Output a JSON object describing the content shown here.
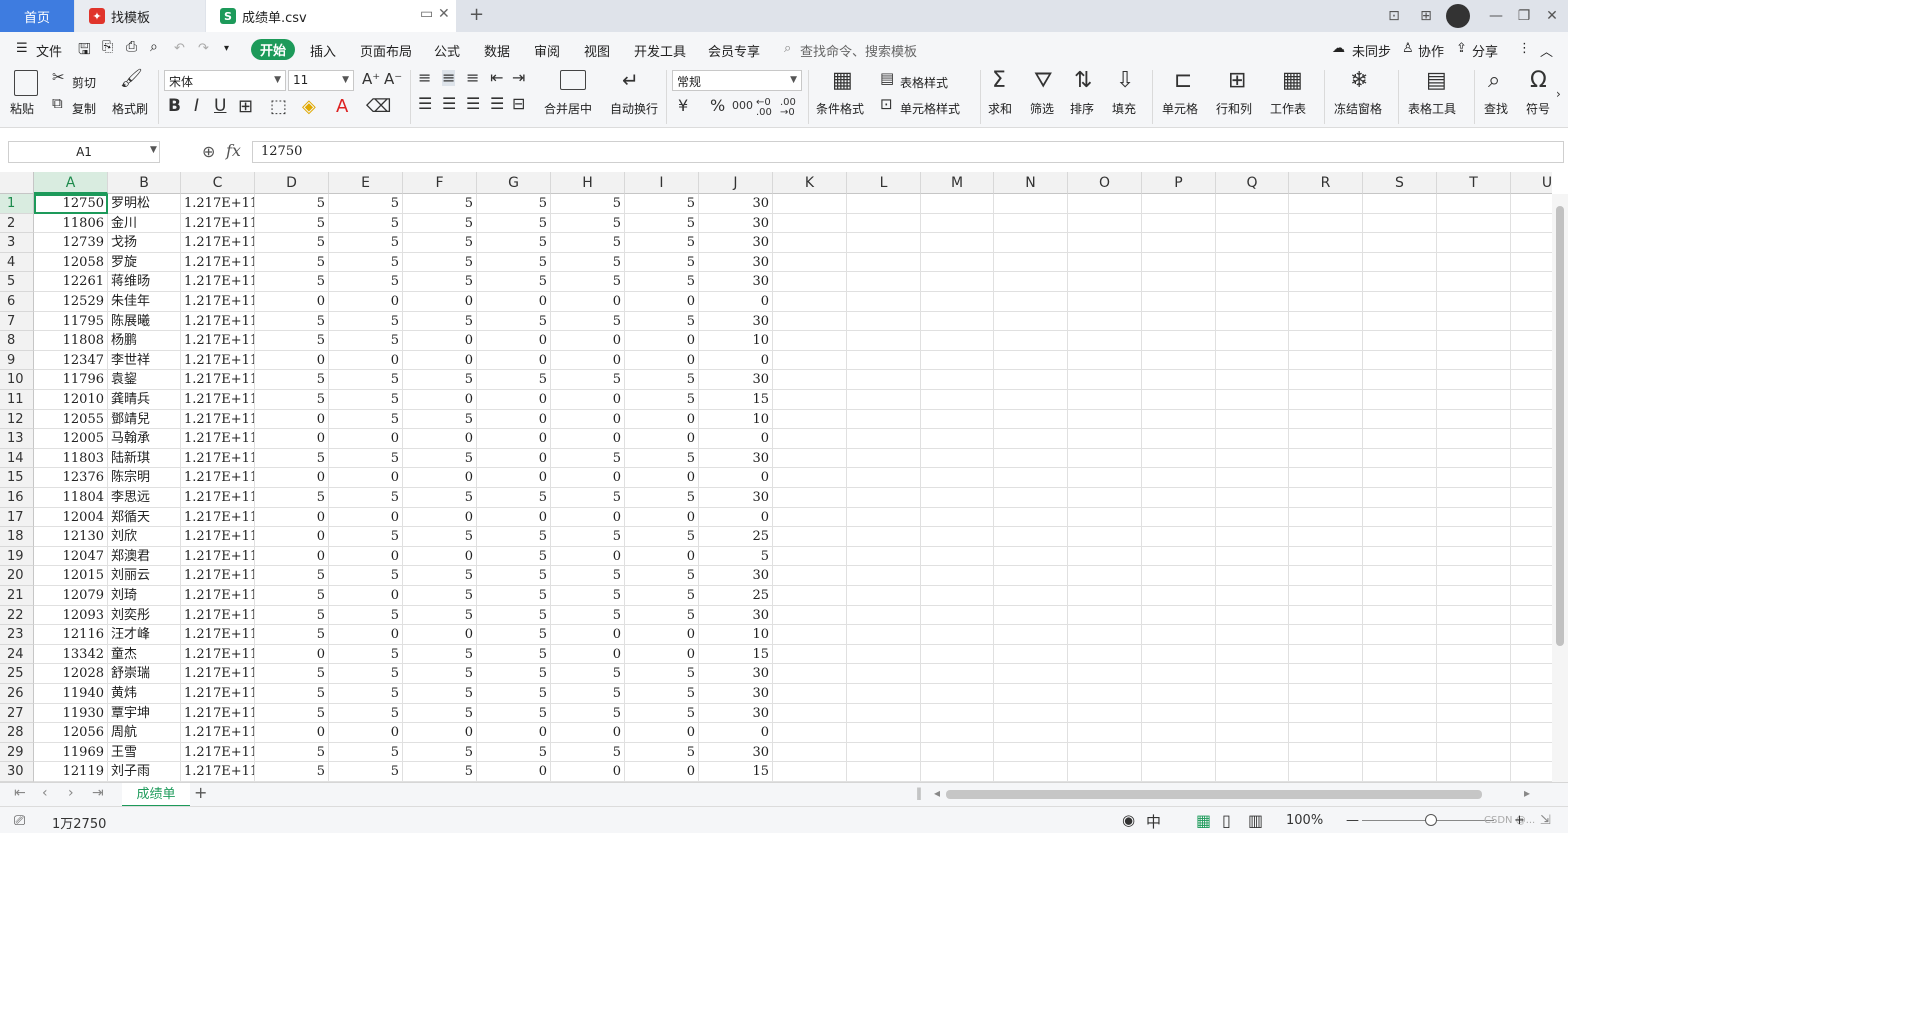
{
  "tabs": {
    "home": "首页",
    "template": "找模板",
    "file": "成绩单.csv",
    "new_tab": "+"
  },
  "menu": {
    "file": "文件",
    "items": [
      "开始",
      "插入",
      "页面布局",
      "公式",
      "数据",
      "审阅",
      "视图",
      "开发工具",
      "会员专享"
    ],
    "search_placeholder": "查找命令、搜索模板",
    "unsynced": "未同步",
    "collab": "协作",
    "share": "分享"
  },
  "ribbon": {
    "paste": "粘贴",
    "cut": "剪切",
    "copy": "复制",
    "format_painter": "格式刷",
    "font_name": "宋体",
    "font_size": "11",
    "merge_center": "合并居中",
    "wrap_text": "自动换行",
    "number_format": "常规",
    "table_style": "表格样式",
    "cell_style": "单元格样式",
    "conditional_format": "条件格式",
    "sum": "求和",
    "filter": "筛选",
    "sort": "排序",
    "fill": "填充",
    "cell": "单元格",
    "row_col": "行和列",
    "worksheet": "工作表",
    "freeze": "冻结窗格",
    "table_tools": "表格工具",
    "find": "查找",
    "symbol": "符号"
  },
  "formula_bar": {
    "name_box": "A1",
    "value": "12750"
  },
  "columns": [
    "A",
    "B",
    "C",
    "D",
    "E",
    "F",
    "G",
    "H",
    "I",
    "J",
    "K",
    "L",
    "M",
    "N",
    "O",
    "P",
    "Q",
    "R",
    "S",
    "T",
    "U"
  ],
  "rows": [
    [
      "12750",
      "罗明松",
      "1.217E+11",
      "5",
      "5",
      "5",
      "5",
      "5",
      "5",
      "30"
    ],
    [
      "11806",
      "金川",
      "1.217E+11",
      "5",
      "5",
      "5",
      "5",
      "5",
      "5",
      "30"
    ],
    [
      "12739",
      "戈扬",
      "1.217E+11",
      "5",
      "5",
      "5",
      "5",
      "5",
      "5",
      "30"
    ],
    [
      "12058",
      "罗旋",
      "1.217E+11",
      "5",
      "5",
      "5",
      "5",
      "5",
      "5",
      "30"
    ],
    [
      "12261",
      "蒋维旸",
      "1.217E+11",
      "5",
      "5",
      "5",
      "5",
      "5",
      "5",
      "30"
    ],
    [
      "12529",
      "朱佳年",
      "1.217E+11",
      "0",
      "0",
      "0",
      "0",
      "0",
      "0",
      "0"
    ],
    [
      "11795",
      "陈展曦",
      "1.217E+11",
      "5",
      "5",
      "5",
      "5",
      "5",
      "5",
      "30"
    ],
    [
      "11808",
      "杨鹏",
      "1.217E+11",
      "5",
      "5",
      "0",
      "0",
      "0",
      "0",
      "10"
    ],
    [
      "12347",
      "李世祥",
      "1.217E+11",
      "0",
      "0",
      "0",
      "0",
      "0",
      "0",
      "0"
    ],
    [
      "11796",
      "袁鋆",
      "1.217E+11",
      "5",
      "5",
      "5",
      "5",
      "5",
      "5",
      "30"
    ],
    [
      "12010",
      "龚晴兵",
      "1.217E+11",
      "5",
      "5",
      "0",
      "0",
      "0",
      "5",
      "15"
    ],
    [
      "12055",
      "鄧靖兒",
      "1.217E+11",
      "0",
      "5",
      "5",
      "0",
      "0",
      "0",
      "10"
    ],
    [
      "12005",
      "马翰承",
      "1.217E+11",
      "0",
      "0",
      "0",
      "0",
      "0",
      "0",
      "0"
    ],
    [
      "11803",
      "陆新琪",
      "1.217E+11",
      "5",
      "5",
      "5",
      "0",
      "5",
      "5",
      "30"
    ],
    [
      "12376",
      "陈宗明",
      "1.217E+11",
      "0",
      "0",
      "0",
      "0",
      "0",
      "0",
      "0"
    ],
    [
      "11804",
      "李思远",
      "1.217E+11",
      "5",
      "5",
      "5",
      "5",
      "5",
      "5",
      "30"
    ],
    [
      "12004",
      "郑循天",
      "1.217E+11",
      "0",
      "0",
      "0",
      "0",
      "0",
      "0",
      "0"
    ],
    [
      "12130",
      "刘欣",
      "1.217E+11",
      "0",
      "5",
      "5",
      "5",
      "5",
      "5",
      "25"
    ],
    [
      "12047",
      "郑澳君",
      "1.217E+11",
      "0",
      "0",
      "0",
      "5",
      "0",
      "0",
      "5"
    ],
    [
      "12015",
      "刘丽云",
      "1.217E+11",
      "5",
      "5",
      "5",
      "5",
      "5",
      "5",
      "30"
    ],
    [
      "12079",
      "刘琦",
      "1.217E+11",
      "5",
      "0",
      "5",
      "5",
      "5",
      "5",
      "25"
    ],
    [
      "12093",
      "刘奕彤",
      "1.217E+11",
      "5",
      "5",
      "5",
      "5",
      "5",
      "5",
      "30"
    ],
    [
      "12116",
      "汪才峰",
      "1.217E+11",
      "5",
      "0",
      "0",
      "5",
      "0",
      "0",
      "10"
    ],
    [
      "13342",
      "童杰",
      "1.217E+11",
      "0",
      "5",
      "5",
      "5",
      "0",
      "0",
      "15"
    ],
    [
      "12028",
      "舒崇瑞",
      "1.217E+11",
      "5",
      "5",
      "5",
      "5",
      "5",
      "5",
      "30"
    ],
    [
      "11940",
      "黄炜",
      "1.217E+11",
      "5",
      "5",
      "5",
      "5",
      "5",
      "5",
      "30"
    ],
    [
      "11930",
      "覃宇坤",
      "1.217E+11",
      "5",
      "5",
      "5",
      "5",
      "5",
      "5",
      "30"
    ],
    [
      "12056",
      "周航",
      "1.217E+11",
      "0",
      "0",
      "0",
      "0",
      "0",
      "0",
      "0"
    ],
    [
      "11969",
      "王雪",
      "1.217E+11",
      "5",
      "5",
      "5",
      "5",
      "5",
      "5",
      "30"
    ],
    [
      "12119",
      "刘子雨",
      "1.217E+11",
      "5",
      "5",
      "5",
      "0",
      "0",
      "0",
      "15"
    ]
  ],
  "sheet": {
    "name": "成绩单",
    "add": "+"
  },
  "status": {
    "summary": "1万2750",
    "zoom": "100%",
    "watermark": "CSDN @..."
  },
  "colors": {
    "accent": "#1d9a5a",
    "home_tab": "#3e7ce0"
  }
}
